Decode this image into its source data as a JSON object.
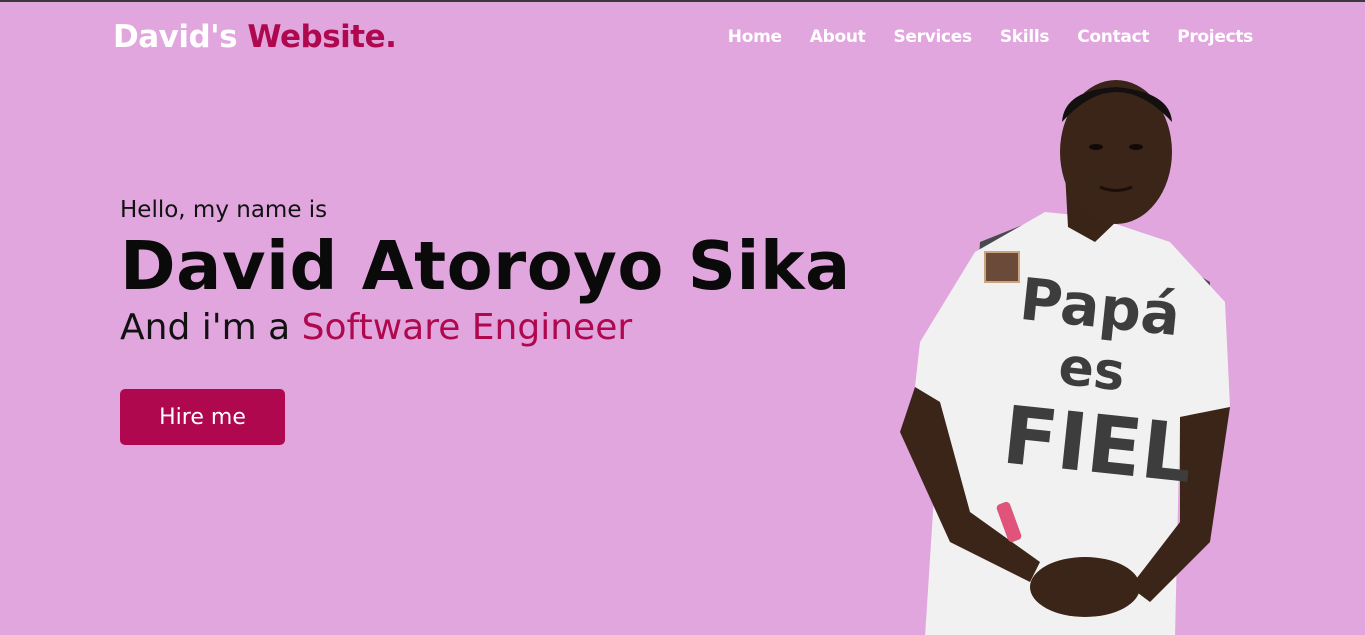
{
  "brand": {
    "first": "David's",
    "second": "Website."
  },
  "nav": {
    "items": [
      "Home",
      "About",
      "Services",
      "Skills",
      "Contact",
      "Projects"
    ]
  },
  "hero": {
    "greeting": "Hello, my name is",
    "name": "David Atoroyo Sika",
    "role_prefix": "And i'm a",
    "role_highlight": "Software Engineer",
    "cta_label": "Hire me"
  },
  "shirt": {
    "line1": "Papá",
    "line2": "es",
    "line3": "FIEL"
  },
  "colors": {
    "background": "#e1a6de",
    "accent": "#b0084f",
    "nav_text": "#ffffff"
  }
}
